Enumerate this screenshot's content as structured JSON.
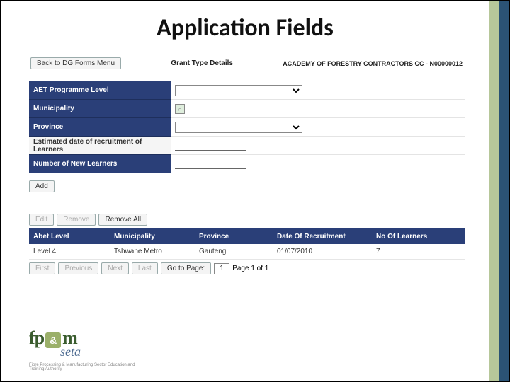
{
  "title": "Application Fields",
  "header": {
    "back_label": "Back to DG Forms Menu",
    "center": "Grant Type Details",
    "right": "ACADEMY OF FORESTRY CONTRACTORS CC - N00000012"
  },
  "form": {
    "aet_label": "AET Programme Level",
    "muni_label": "Municipality",
    "province_label": "Province",
    "date_label": "Estimated date of recruitment of Learners",
    "learners_label": "Number of New Learners",
    "aet_value": "",
    "province_value": "",
    "date_value": "",
    "learners_value": ""
  },
  "buttons": {
    "add": "Add",
    "edit": "Edit",
    "remove": "Remove",
    "remove_all": "Remove All",
    "first": "First",
    "prev": "Previous",
    "next": "Next",
    "last": "Last",
    "goto": "Go to Page:"
  },
  "grid": {
    "h1": "Abet Level",
    "h2": "Municipality",
    "h3": "Province",
    "h4": "Date Of Recruitment",
    "h5": "No Of Learners",
    "row": {
      "c1": "Level 4",
      "c2": "Tshwane Metro",
      "c3": "Gauteng",
      "c4": "01/07/2010",
      "c5": "7"
    }
  },
  "pager": {
    "page_value": "1",
    "page_text": "Page 1 of 1"
  },
  "logo": {
    "fp": "fp",
    "amp": "&",
    "m": "m",
    "seta": "seta",
    "tag": "Fibre Processing & Manufacturing Sector Education and Training Authority"
  }
}
